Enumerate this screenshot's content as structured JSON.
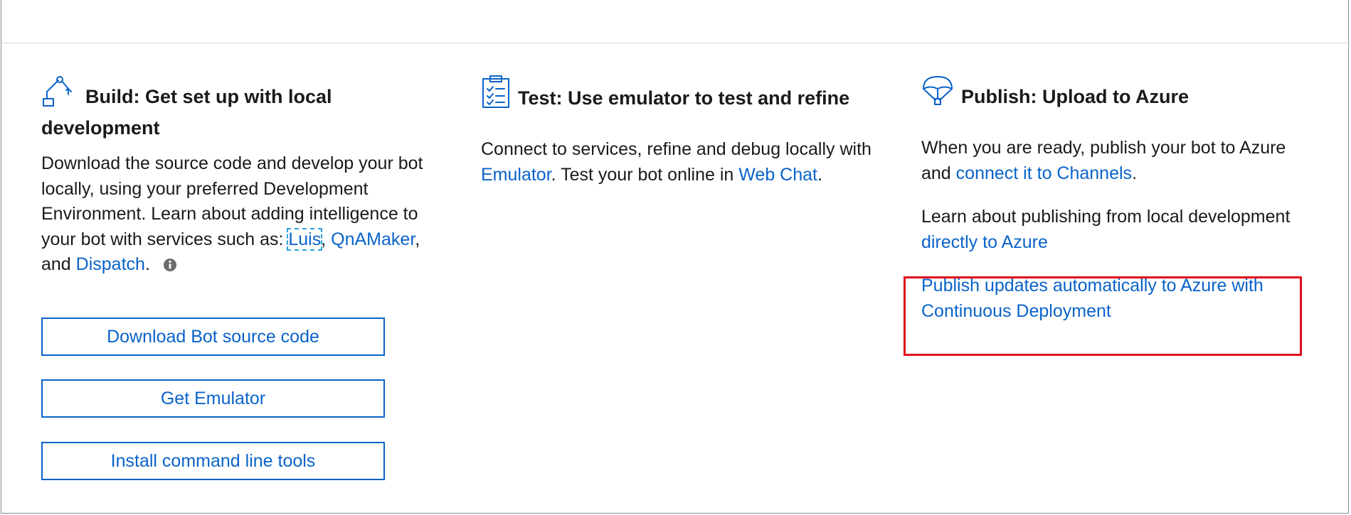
{
  "build": {
    "heading_bold": "Build:",
    "heading_rest": " Get set up with local development",
    "para": {
      "t1": "Download the source code and develop your bot locally, using your preferred Development Environment. Learn about adding intelligence to your bot with services such as: ",
      "luis": "Luis",
      "t2": ", ",
      "qna": "QnAMaker",
      "t3": ", and ",
      "dispatch": "Dispatch",
      "t4": "."
    },
    "buttons": {
      "download": "Download Bot source code",
      "emulator": "Get Emulator",
      "cli": "Install command line tools"
    }
  },
  "test": {
    "heading_bold": "Test:",
    "heading_rest": " Use emulator to test and refine",
    "para": {
      "t1": "Connect to services, refine and debug locally with ",
      "emulator": "Emulator",
      "t2": ". Test your bot online in ",
      "webchat": "Web Chat",
      "t3": "."
    }
  },
  "publish": {
    "heading_bold": "Publish:",
    "heading_rest": " Upload to Azure",
    "para1": {
      "t1": "When you are ready, publish your bot to Azure and ",
      "channels": "connect it to Channels",
      "t2": "."
    },
    "para2": {
      "t1": "Learn about publishing from local development ",
      "azure": "directly to Azure"
    },
    "cd_link": "Publish updates automatically to Azure with Continuous Deployment"
  },
  "colors": {
    "link": "#0a63c9",
    "highlight": "#e0101a",
    "focus_outline": "#2aa4dc"
  },
  "icons": {
    "build": "robot-arm-icon",
    "test": "clipboard-checklist-icon",
    "publish": "parachute-icon",
    "info": "info-icon"
  }
}
